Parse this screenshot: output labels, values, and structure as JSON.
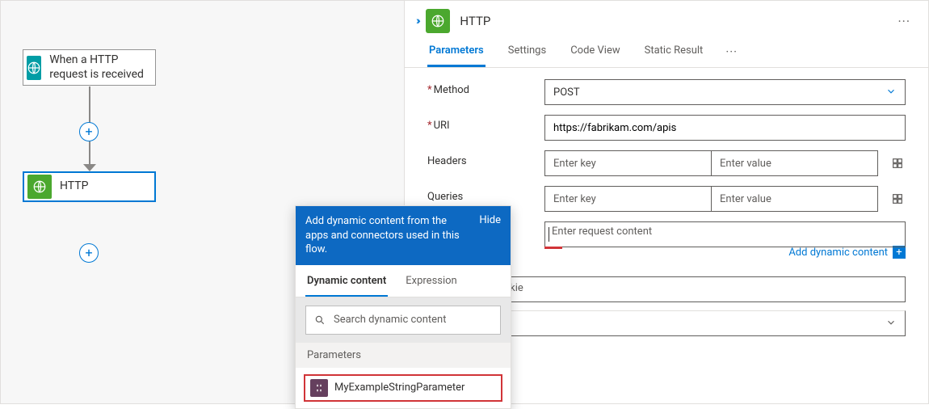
{
  "canvas": {
    "node_trigger_label": "When a HTTP request is received",
    "node_http_label": "HTTP"
  },
  "panel": {
    "title": "HTTP",
    "tabs": [
      "Parameters",
      "Settings",
      "Code View",
      "Static Result"
    ],
    "labels": {
      "method": "Method",
      "uri": "URI",
      "headers": "Headers",
      "queries": "Queries"
    },
    "values": {
      "method": "POST",
      "uri": "https://fabrikam.com/apis"
    },
    "placeholders": {
      "enter_key": "Enter key",
      "enter_value": "Enter value",
      "body": "Enter request content",
      "cookie": "Enter HTTP cookie"
    },
    "add_dynamic_link": "Add dynamic content"
  },
  "popup": {
    "desc": "Add dynamic content from the apps and connectors used in this flow.",
    "hide": "Hide",
    "tabs": [
      "Dynamic content",
      "Expression"
    ],
    "search_placeholder": "Search dynamic content",
    "section_label": "Parameters",
    "item_label": "MyExampleStringParameter"
  }
}
